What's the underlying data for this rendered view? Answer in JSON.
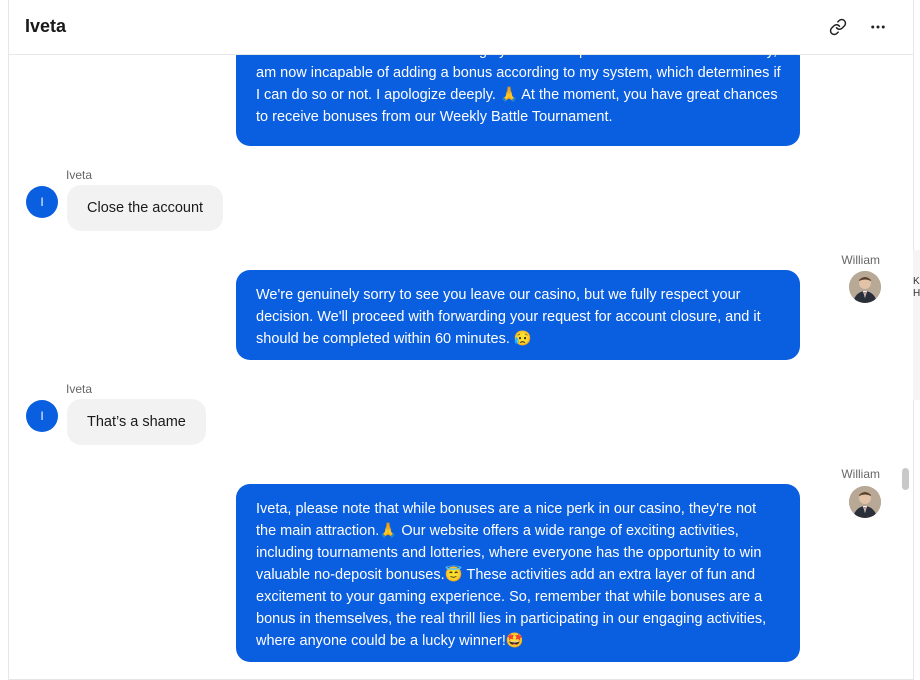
{
  "header": {
    "title": "Iveta",
    "link_icon": "link-icon",
    "more_icon": "more-horizontal-icon"
  },
  "messages": [
    {
      "sender": "William",
      "role": "agent",
      "text": "wish alone is insufficient even though you are a superb and kind customer. Sadly, I am now incapable of adding a bonus according to my system, which determines if I can do so or not. I apologize deeply. 🙏 At the moment, you have great chances to receive bonuses from our Weekly Battle Tournament."
    },
    {
      "sender": "Iveta",
      "role": "user",
      "avatar_initial": "I",
      "text": "Close the account"
    },
    {
      "sender": "William",
      "role": "agent",
      "text": "We're genuinely sorry to see you leave our casino, but we fully respect your decision. We'll proceed with forwarding your request for account closure, and it should be completed within 60 minutes. 😥"
    },
    {
      "sender": "Iveta",
      "role": "user",
      "avatar_initial": "I",
      "text": "That’s a shame"
    },
    {
      "sender": "William",
      "role": "agent",
      "text": "Iveta, please note that while bonuses are a nice perk in our casino, they're not the main attraction.🙏 Our website offers a wide range of exciting activities, including tournaments and lotteries, where everyone has the opportunity to win valuable no-deposit bonuses.😇 These activities add an extra layer of fun and excitement to your gaming experience. So, remember that while bonuses are a bonus in themselves, the real thrill lies in participating in our engaging activities, where anyone could be a lucky winner!🤩"
    }
  ],
  "right_edge_fragments": [
    "K",
    "H"
  ],
  "colors": {
    "agent_bubble": "#0a5ee0",
    "user_bubble": "#f2f2f2",
    "user_avatar": "#0a5ee0"
  }
}
